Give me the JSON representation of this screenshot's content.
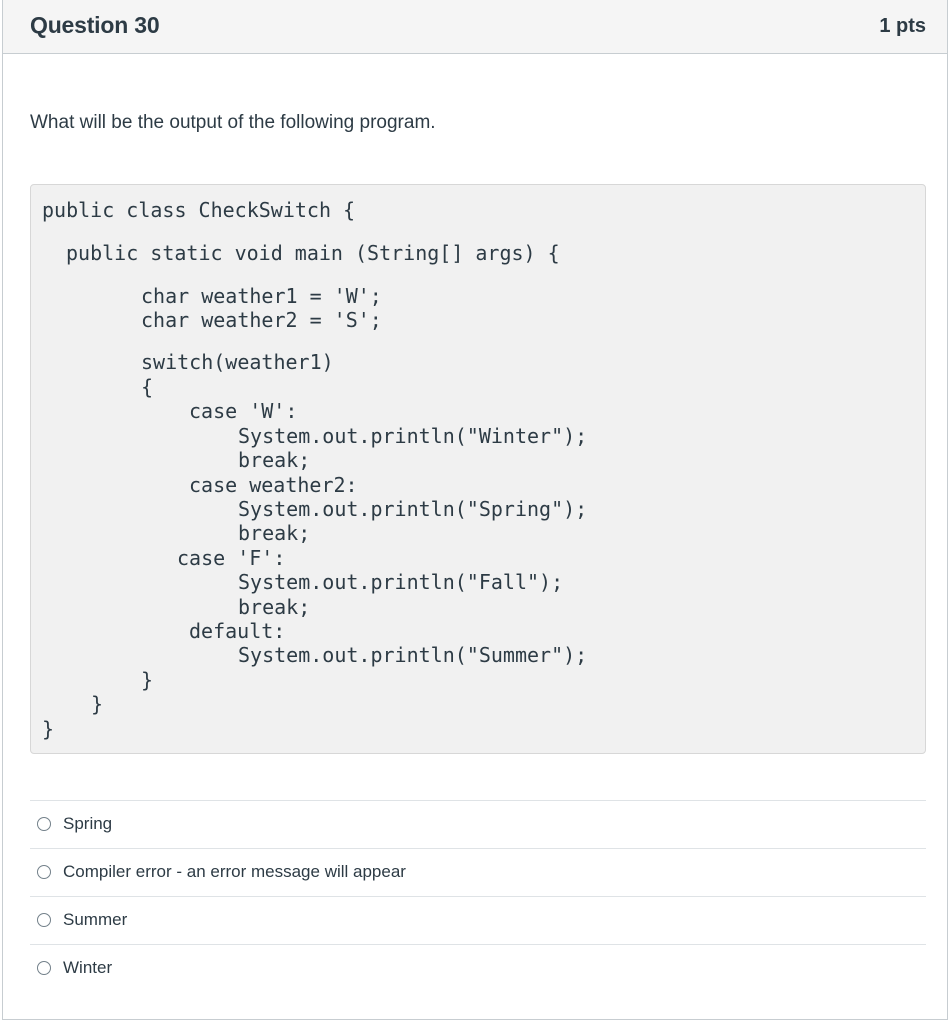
{
  "question": {
    "title": "Question 30",
    "points": "1 pts",
    "prompt": "What will be the output of the following program."
  },
  "code": {
    "lines": [
      "public class CheckSwitch {",
      "public static void main (String[] args) {",
      "char weather1 = 'W';",
      "char weather2 = 'S';",
      "switch(weather1)",
      "{",
      "case 'W':",
      "System.out.println(\"Winter\");",
      "break;",
      "case weather2:",
      "System.out.println(\"Spring\");",
      "break;",
      "case 'F':",
      "System.out.println(\"Fall\");",
      "break;",
      "default:",
      "System.out.println(\"Summer\");",
      "}",
      "}",
      "}"
    ]
  },
  "answers": [
    {
      "label": "Spring",
      "selected": false
    },
    {
      "label": "Compiler error - an error message will appear",
      "selected": false
    },
    {
      "label": "Summer",
      "selected": false
    },
    {
      "label": "Winter",
      "selected": false
    }
  ]
}
